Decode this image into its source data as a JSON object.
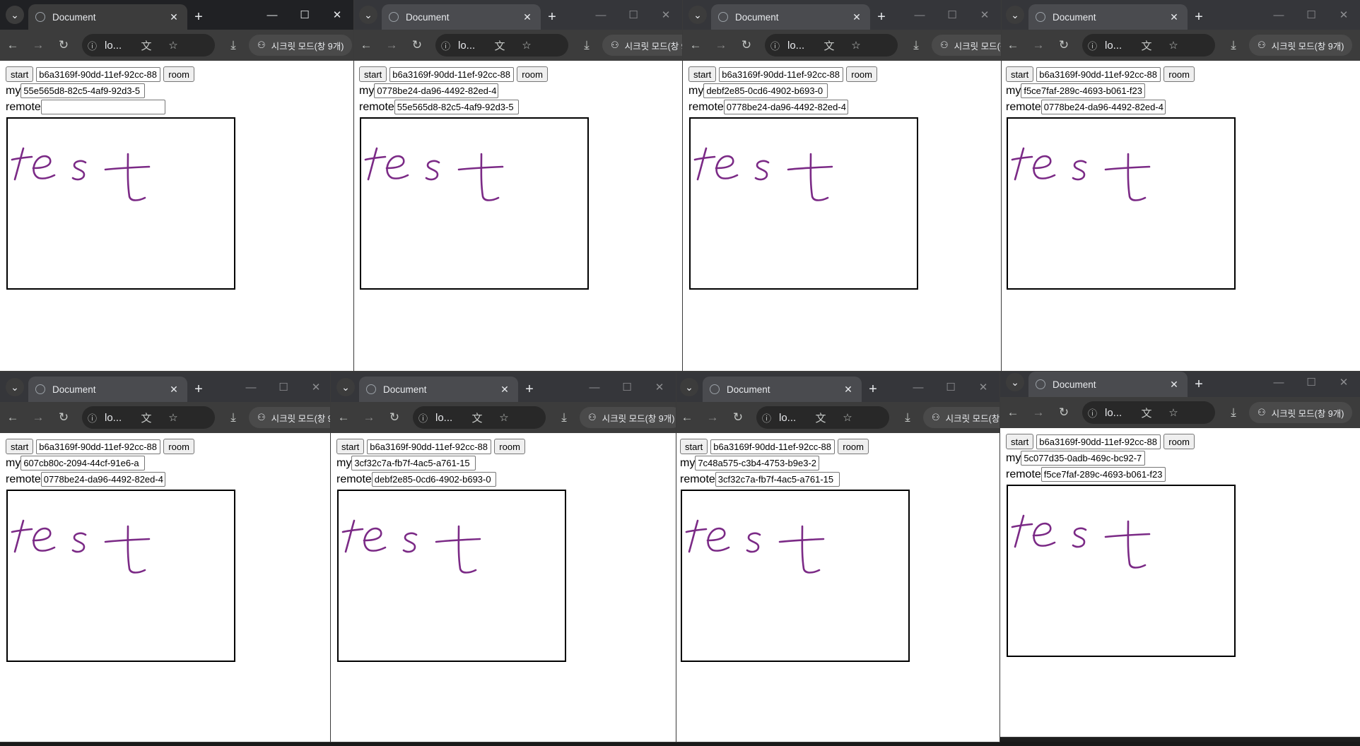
{
  "browser": {
    "tab_title": "Document",
    "address": "lo...",
    "incognito_label": "시크릿 모드(창 9개)"
  },
  "page": {
    "start_label": "start",
    "room_label": "room",
    "my_label": "my",
    "remote_label": "remote",
    "room_value": "b6a3169f-90dd-11ef-92cc-88",
    "drawing_text": "test",
    "ink_color": "#7b2a86"
  },
  "windows": [
    {
      "my": "55e565d8-82c5-4af9-92d3-5",
      "remote": ""
    },
    {
      "my": "0778be24-da96-4492-82ed-4",
      "remote": "55e565d8-82c5-4af9-92d3-5"
    },
    {
      "my": "debf2e85-0cd6-4902-b693-0",
      "remote": "0778be24-da96-4492-82ed-4"
    },
    {
      "my": "f5ce7faf-289c-4693-b061-f23",
      "remote": "0778be24-da96-4492-82ed-4"
    },
    {
      "my": "607cb80c-2094-44cf-91e6-a",
      "remote": "0778be24-da96-4492-82ed-4"
    },
    {
      "my": "3cf32c7a-fb7f-4ac5-a761-15",
      "remote": "debf2e85-0cd6-4902-b693-0"
    },
    {
      "my": "7c48a575-c3b4-4753-b9e3-2",
      "remote": "3cf32c7a-fb7f-4ac5-a761-15"
    },
    {
      "my": "5c077d35-0adb-469c-bc92-7",
      "remote": "f5ce7faf-289c-4693-b061-f23"
    }
  ]
}
